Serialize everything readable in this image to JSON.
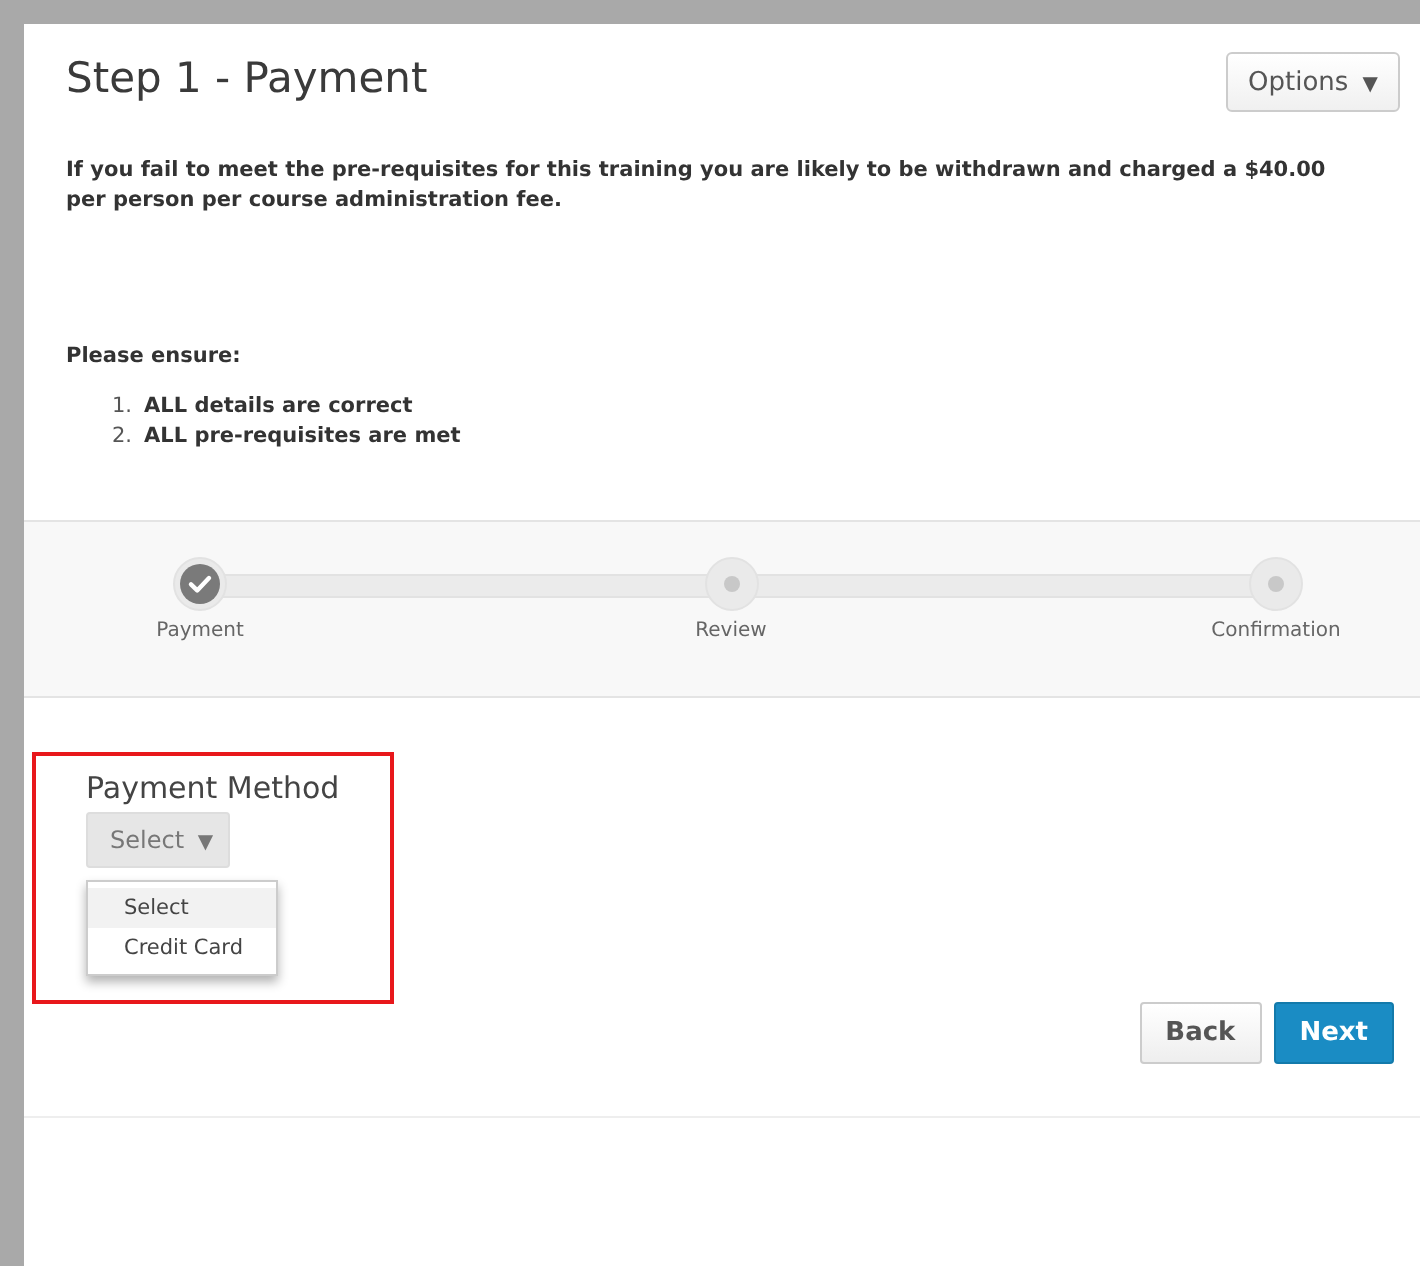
{
  "title": "Step 1 - Payment",
  "options_button": {
    "label": "Options",
    "caret": "▼"
  },
  "notice": "If you fail to meet the pre-requisites for this training you are likely to be withdrawn and charged a $40.00 per person per course administration fee.",
  "ensure_heading": "Please ensure:",
  "ensure_items": [
    {
      "number": "1.",
      "text": "ALL details are correct"
    },
    {
      "number": "2.",
      "text": "ALL pre-requisites are met"
    }
  ],
  "steps": [
    {
      "label": "Payment",
      "done": true
    },
    {
      "label": "Review",
      "done": false
    },
    {
      "label": "Confirmation",
      "done": false
    }
  ],
  "payment_method": {
    "label": "Payment Method",
    "select": {
      "value": "Select",
      "caret": "▼"
    },
    "options": [
      {
        "label": "Select",
        "selected": true
      },
      {
        "label": "Credit Card",
        "selected": false
      }
    ]
  },
  "buttons": [
    {
      "label": "Back",
      "kind": "secondary"
    },
    {
      "label": "Next",
      "kind": "primary"
    }
  ]
}
